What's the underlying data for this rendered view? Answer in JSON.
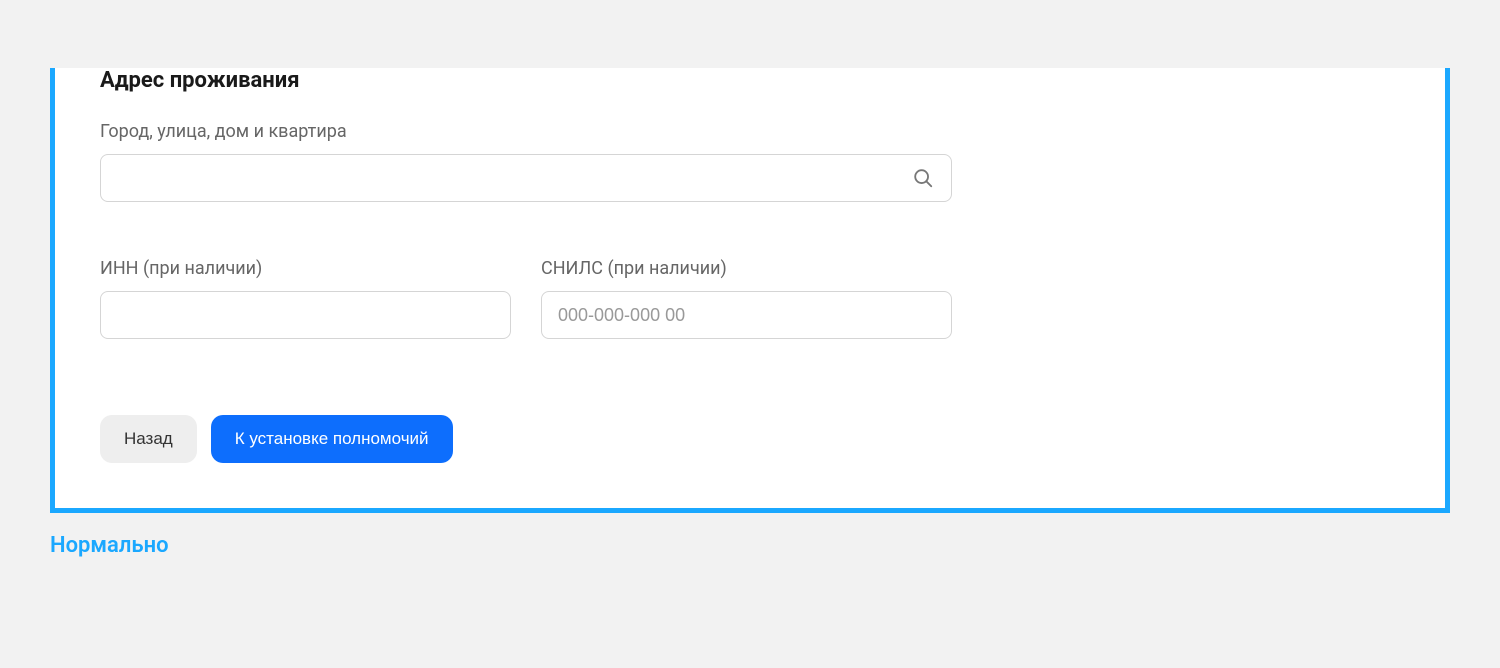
{
  "form": {
    "section_title": "Адрес проживания",
    "address": {
      "label": "Город, улица, дом и квартира",
      "value": ""
    },
    "inn": {
      "label": "ИНН (при наличии)",
      "value": ""
    },
    "snils": {
      "label": "СНИЛС (при наличии)",
      "value": "",
      "placeholder": "000-000-000 00"
    }
  },
  "buttons": {
    "back": "Назад",
    "next": "К установке полномочий"
  },
  "status": "Нормально",
  "colors": {
    "accent": "#1ba8ff",
    "primary": "#0d6efd"
  }
}
